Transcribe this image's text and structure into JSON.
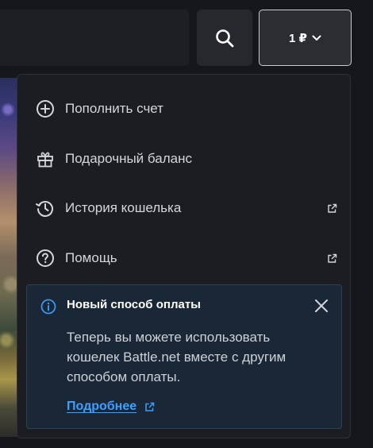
{
  "header": {
    "search_button_icon": "search-icon",
    "balance_label": "1 ₽",
    "balance_chevron_icon": "chevron-down-icon"
  },
  "menu": {
    "items": [
      {
        "label": "Пополнить счет",
        "icon": "plus-circle-icon",
        "external": false
      },
      {
        "label": "Подарочный баланс",
        "icon": "gift-icon",
        "external": false
      },
      {
        "label": "История кошелька",
        "icon": "history-icon",
        "external": true
      },
      {
        "label": "Помощь",
        "icon": "help-circle-icon",
        "external": true
      }
    ]
  },
  "notice": {
    "icon": "info-icon",
    "title": "Новый способ оплаты",
    "body": "Теперь вы можете использовать кошелек Battle.net вместе с другим способом оплаты.",
    "link_label": "Подробнее",
    "link_icon": "external-link-icon",
    "close_icon": "close-icon"
  },
  "colors": {
    "background": "#15171c",
    "panel": "#1b1d22",
    "notice_bg": "#1a2736",
    "notice_border": "#2c4157",
    "accent_link": "#3aa0ff",
    "info_icon": "#3a97f0",
    "text": "#d4d6db"
  }
}
